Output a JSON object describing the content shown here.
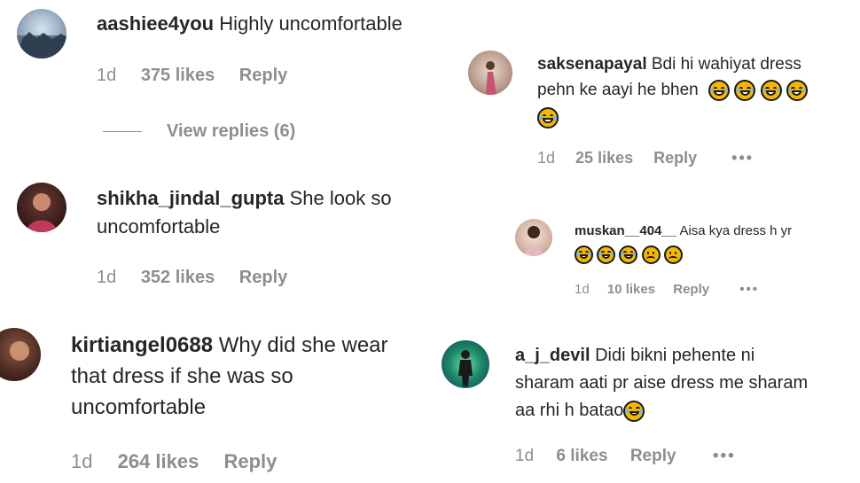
{
  "comments": [
    {
      "username": "aashiee4you",
      "text": "Highly uncomfortable",
      "time": "1d",
      "likes": "375 likes",
      "reply": "Reply",
      "view_replies": "View replies (6)"
    },
    {
      "username": "shikha_jindal_gupta",
      "text": "She look so",
      "text_line2": "uncomfortable",
      "time": "1d",
      "likes": "352 likes",
      "reply": "Reply"
    },
    {
      "username": "kirtiangel0688",
      "text": "Why did she wear",
      "text_line2": "that dress if she was so",
      "text_line3": "uncomfortable",
      "time": "1d",
      "likes": "264 likes",
      "reply": "Reply"
    },
    {
      "username": "saksenapayal",
      "text": "Bdi hi wahiyat dress",
      "text_line2": "pehn ke aayi he bhen",
      "time": "1d",
      "likes": "25 likes",
      "reply": "Reply",
      "more": "•••"
    },
    {
      "username": "muskan__404__",
      "text": "Aisa kya dress h yr",
      "time": "1d",
      "likes": "10 likes",
      "reply": "Reply",
      "more": "•••"
    },
    {
      "username": "a_j_devil",
      "text": "Didi bikni pehente ni",
      "text_line2": "sharam aati pr aise dress me sharam",
      "text_line3": "aa rhi h batao",
      "time": "1d",
      "likes": "6 likes",
      "reply": "Reply",
      "more": "•••"
    }
  ],
  "icons": {
    "laugh_emoji": "face-with-tears-of-joy",
    "sad_emoji": "frowning-face"
  },
  "colors": {
    "text": "#262626",
    "meta": "#8e8e8e",
    "emoji": "#f2b705"
  }
}
